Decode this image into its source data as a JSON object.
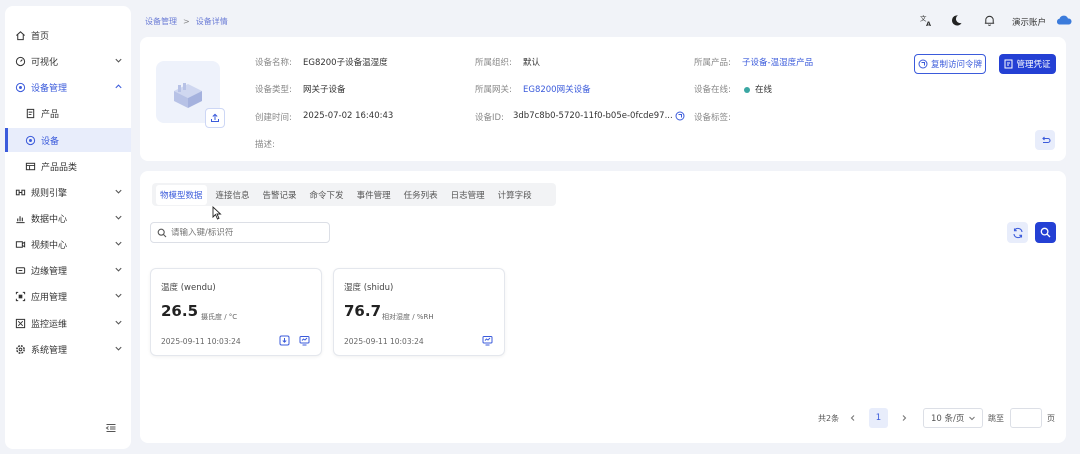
{
  "sidebar": {
    "items": [
      {
        "label": "首页",
        "icon": "home-icon",
        "has_arrow": false
      },
      {
        "label": "可视化",
        "icon": "dashboard-icon",
        "has_arrow": true
      },
      {
        "label": "设备管理",
        "icon": "device-icon",
        "has_arrow": true,
        "expanded": true
      },
      {
        "label": "产品",
        "icon": "product-icon",
        "sub": true
      },
      {
        "label": "设备",
        "icon": "device-icon",
        "sub": true,
        "active": true
      },
      {
        "label": "产品品类",
        "icon": "category-icon",
        "sub": true
      },
      {
        "label": "规则引擎",
        "icon": "rule-icon",
        "has_arrow": true
      },
      {
        "label": "数据中心",
        "icon": "chart-icon",
        "has_arrow": true
      },
      {
        "label": "视频中心",
        "icon": "video-icon",
        "has_arrow": true
      },
      {
        "label": "边缘管理",
        "icon": "edge-icon",
        "has_arrow": true
      },
      {
        "label": "应用管理",
        "icon": "app-icon",
        "has_arrow": true
      },
      {
        "label": "监控运维",
        "icon": "monitor-icon",
        "has_arrow": true
      },
      {
        "label": "系统管理",
        "icon": "settings-icon",
        "has_arrow": true
      }
    ]
  },
  "header": {
    "breadcrumb": [
      "设备管理",
      "设备详情"
    ],
    "breadcrumb_sep": ">",
    "user": "演示账户"
  },
  "device": {
    "name_label": "设备名称:",
    "name": "EG8200子设备温湿度",
    "type_label": "设备类型:",
    "type": "网关子设备",
    "created_label": "创建时间:",
    "created": "2025-07-02 16:40:43",
    "desc_label": "描述:",
    "org_label": "所属组织:",
    "org": "默认",
    "gateway_label": "所属网关:",
    "gateway": "EG8200网关设备",
    "id_label": "设备ID:",
    "id": "3db7c8b0-5720-11f0-b05e-0fcde97...",
    "product_label": "所属产品:",
    "product": "子设备-温湿度产品",
    "online_label": "设备在线:",
    "online": "在线",
    "tags_label": "设备标签:",
    "copy_token_btn": "复制访问令牌",
    "manage_cred_btn": "管理凭证"
  },
  "tabs": [
    "物模型数据",
    "连接信息",
    "告警记录",
    "命令下发",
    "事件管理",
    "任务列表",
    "日志管理",
    "计算字段"
  ],
  "search": {
    "placeholder": "请输入键/标识符"
  },
  "properties": [
    {
      "name": "温度 (wendu)",
      "value": "26.5",
      "unit": "摄氏度 / °C",
      "time": "2025-09-11 10:03:24"
    },
    {
      "name": "湿度 (shidu)",
      "value": "76.7",
      "unit": "相对湿度 / %RH",
      "time": "2025-09-11 10:03:24"
    }
  ],
  "pagination": {
    "total": "共2条",
    "current": "1",
    "page_size": "10 条/页",
    "jump_label": "跳至",
    "page_suffix": "页"
  },
  "colors": {
    "accent": "#3b5bdb",
    "primary_btn": "#2440d4",
    "online": "#3aa7a3"
  }
}
